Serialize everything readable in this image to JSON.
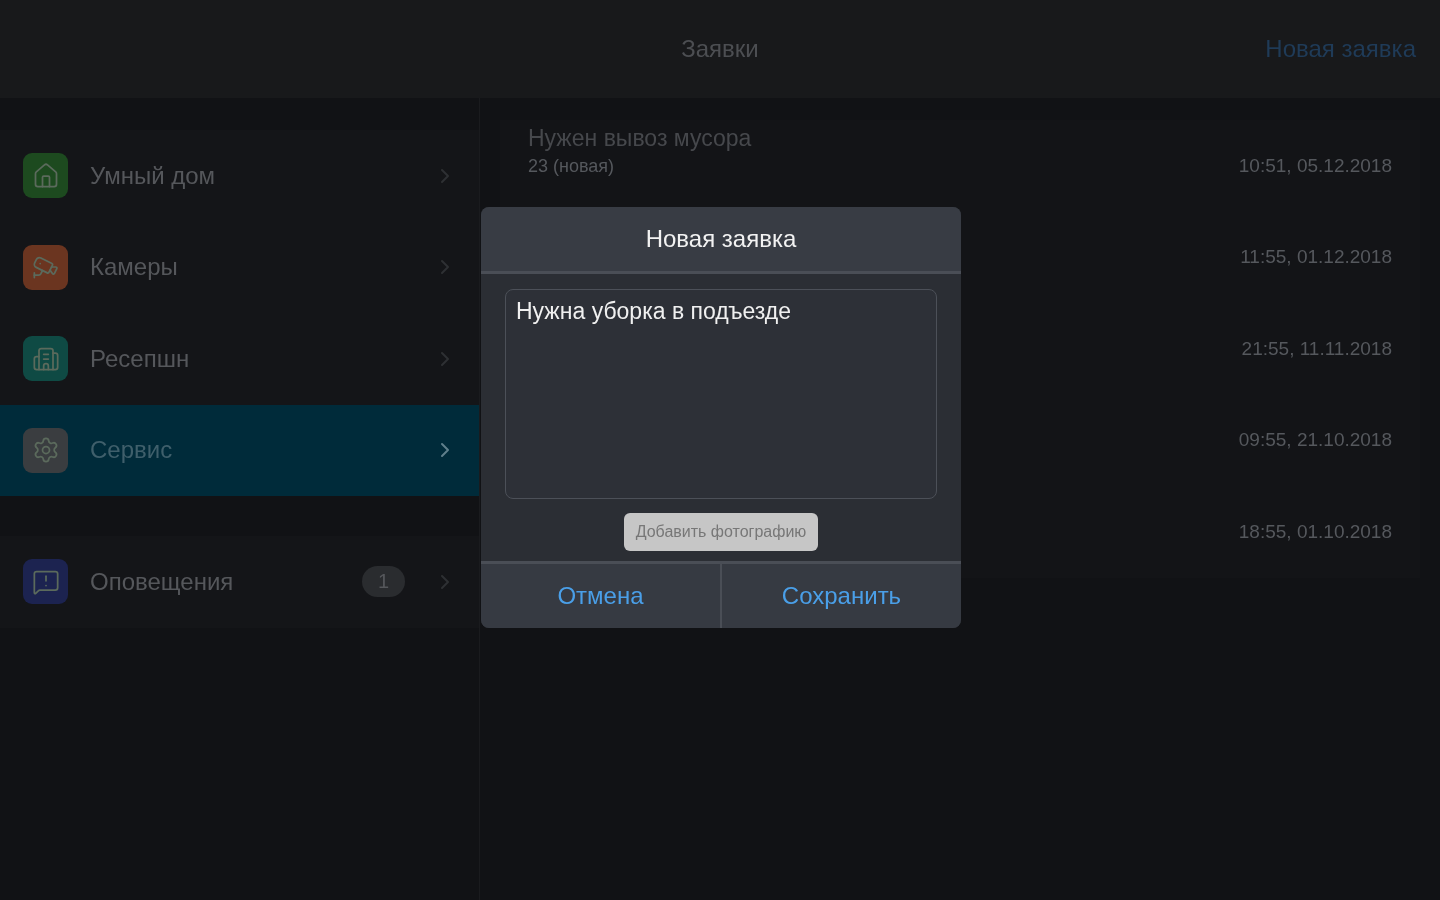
{
  "header": {
    "title": "Заявки",
    "action": "Новая заявка"
  },
  "sidebar": {
    "items": [
      {
        "kind": "home",
        "label": "Умный дом",
        "selected": false,
        "color": "#1d4a1f"
      },
      {
        "kind": "camera",
        "label": "Камеры",
        "selected": false,
        "color": "#6b3520"
      },
      {
        "kind": "building",
        "label": "Ресепшн",
        "selected": false,
        "color": "#0f4a44"
      },
      {
        "kind": "service",
        "label": "Сервис",
        "selected": true,
        "color": "#3a3d40"
      }
    ],
    "notifications": {
      "kind": "alert",
      "label": "Оповещения",
      "badge": "1",
      "selected": false,
      "color": "#1c2350"
    }
  },
  "requests": [
    {
      "title": "Нужен вывоз мусора",
      "status": "23 (новая)",
      "time": "10:51, 05.12.2018"
    },
    {
      "time": "11:55, 01.12.2018"
    },
    {
      "time": "21:55, 11.11.2018"
    },
    {
      "time": "09:55, 21.10.2018"
    },
    {
      "time": "18:55, 01.10.2018"
    }
  ],
  "dialog": {
    "title": "Новая заявка",
    "text": "Нужна уборка в подъезде",
    "photo_button": "Добавить фотографию",
    "buttons": [
      "Отмена",
      "Сохранить"
    ]
  }
}
